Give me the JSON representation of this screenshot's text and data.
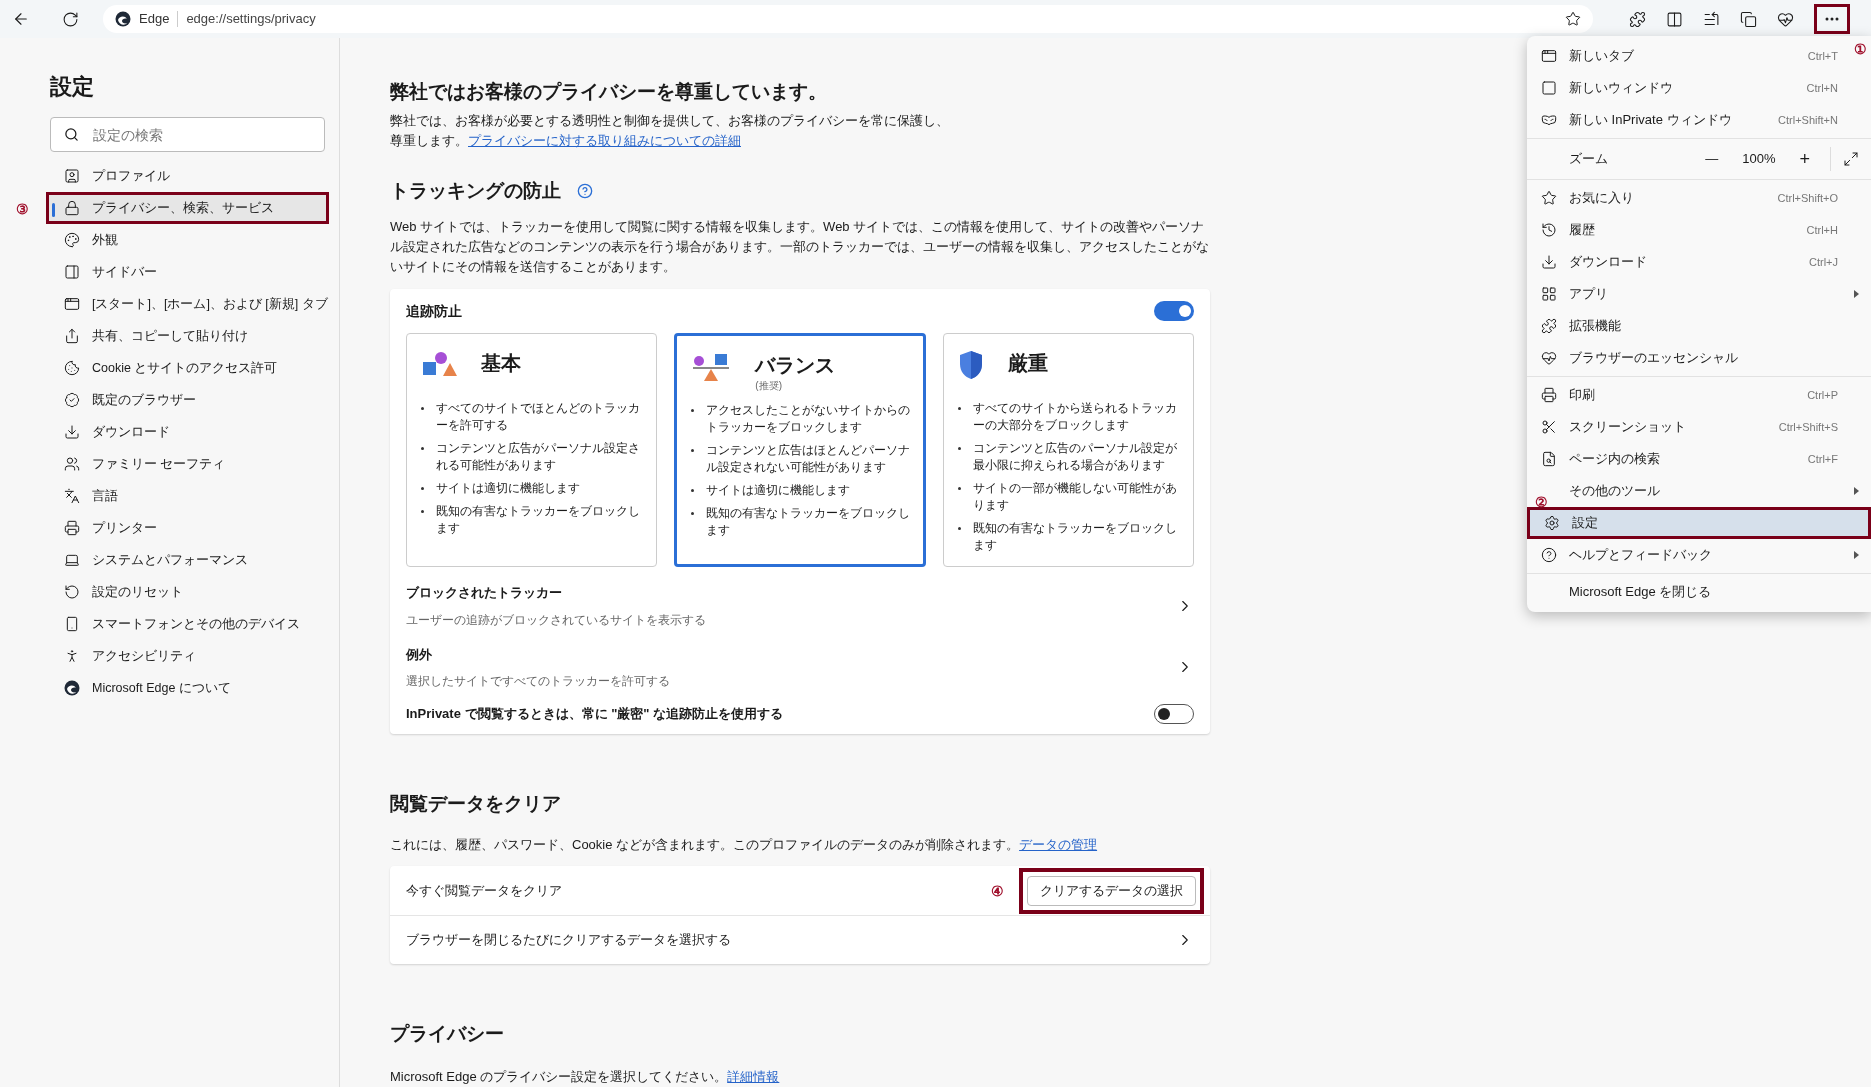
{
  "toolbar": {
    "site_label": "Edge",
    "url": "edge://settings/privacy",
    "more_callout": "①"
  },
  "sidebar": {
    "title": "設定",
    "search": {
      "placeholder": "設定の検索"
    },
    "items": [
      {
        "label": "プロファイル",
        "selected": false
      },
      {
        "label": "プライバシー、検索、サービス",
        "selected": true,
        "callout": "③"
      },
      {
        "label": "外観",
        "selected": false
      },
      {
        "label": "サイドバー",
        "selected": false
      },
      {
        "label": "[スタート]、[ホーム]、および [新規] タブ",
        "selected": false
      },
      {
        "label": "共有、コピーして貼り付け",
        "selected": false
      },
      {
        "label": "Cookie とサイトのアクセス許可",
        "selected": false
      },
      {
        "label": "既定のブラウザー",
        "selected": false
      },
      {
        "label": "ダウンロード",
        "selected": false
      },
      {
        "label": "ファミリー セーフティ",
        "selected": false
      },
      {
        "label": "言語",
        "selected": false
      },
      {
        "label": "プリンター",
        "selected": false
      },
      {
        "label": "システムとパフォーマンス",
        "selected": false
      },
      {
        "label": "設定のリセット",
        "selected": false
      },
      {
        "label": "スマートフォンとその他のデバイス",
        "selected": false
      },
      {
        "label": "アクセシビリティ",
        "selected": false
      },
      {
        "label": "Microsoft Edge について",
        "selected": false
      }
    ]
  },
  "intro": {
    "title": "弊社ではお客様のプライバシーを尊重しています。",
    "text": "弊社では、お客様が必要とする透明性と制御を提供して、お客様のプライバシーを常に保護し、尊重します。",
    "link": "プライバシーに対する取り組みについての詳細"
  },
  "tracking": {
    "title": "トラッキングの防止",
    "description": "Web サイトでは、トラッカーを使用して閲覧に関する情報を収集します。Web サイトでは、この情報を使用して、サイトの改善やパーソナル設定された広告などのコンテンツの表示を行う場合があります。一部のトラッカーでは、ユーザーの情報を収集し、アクセスしたことがないサイトにその情報を送信することがあります。",
    "card_title": "追跡防止",
    "on": true,
    "levels": [
      {
        "title": "基本",
        "selected": false,
        "bullets": [
          "すべてのサイトでほとんどのトラッカーを許可する",
          "コンテンツと広告がパーソナル設定される可能性があります",
          "サイトは適切に機能します",
          "既知の有害なトラッカーをブロックします"
        ]
      },
      {
        "title": "バランス",
        "subtitle": "(推奨)",
        "selected": true,
        "bullets": [
          "アクセスしたことがないサイトからのトラッカーをブロックします",
          "コンテンツと広告はほとんどパーソナル設定されない可能性があります",
          "サイトは適切に機能します",
          "既知の有害なトラッカーをブロックします"
        ]
      },
      {
        "title": "厳重",
        "selected": false,
        "bullets": [
          "すべてのサイトから送られるトラッカーの大部分をブロックします",
          "コンテンツと広告のパーソナル設定が最小限に抑えられる場合があります",
          "サイトの一部が機能しない可能性があります",
          "既知の有害なトラッカーをブロックします"
        ]
      }
    ],
    "rows": [
      {
        "title": "ブロックされたトラッカー",
        "description": "ユーザーの追跡がブロックされているサイトを表示する"
      },
      {
        "title": "例外",
        "description": "選択したサイトですべてのトラッカーを許可する"
      }
    ],
    "inprivate": {
      "label": "InPrivate で閲覧するときは、常に \"厳密\" な追跡防止を使用する",
      "on": false
    }
  },
  "clear": {
    "title": "閲覧データをクリア",
    "text": "これには、履歴、パスワード、Cookie などが含まれます。このプロファイルのデータのみが削除されます。",
    "link": "データの管理",
    "rows": [
      {
        "kind": "button",
        "label": "今すぐ閲覧データをクリア",
        "button": "クリアするデータの選択",
        "callout": "④"
      },
      {
        "kind": "chevron",
        "label": "ブラウザーを閉じるたびにクリアするデータを選択する"
      }
    ]
  },
  "privacy": {
    "title": "プライバシー",
    "text": "Microsoft Edge のプライバシー設定を選択してください。",
    "link": "詳細情報"
  },
  "menu": {
    "groups": [
      [
        {
          "kind": "item",
          "label": "新しいタブ",
          "shortcut": "Ctrl+T"
        },
        {
          "kind": "item",
          "label": "新しいウィンドウ",
          "shortcut": "Ctrl+N"
        },
        {
          "kind": "item",
          "label": "新しい InPrivate ウィンドウ",
          "shortcut": "Ctrl+Shift+N"
        }
      ],
      [
        {
          "kind": "zoom",
          "label": "ズーム",
          "minus": "—",
          "value": "100%",
          "plus": "+"
        }
      ],
      [
        {
          "kind": "item",
          "label": "お気に入り",
          "shortcut": "Ctrl+Shift+O"
        },
        {
          "kind": "item",
          "label": "履歴",
          "shortcut": "Ctrl+H"
        },
        {
          "kind": "item",
          "label": "ダウンロード",
          "shortcut": "Ctrl+J"
        },
        {
          "kind": "item",
          "label": "アプリ",
          "submenu": true
        },
        {
          "kind": "item",
          "label": "拡張機能"
        },
        {
          "kind": "item",
          "label": "ブラウザーのエッセンシャル"
        }
      ],
      [
        {
          "kind": "item",
          "label": "印刷",
          "shortcut": "Ctrl+P"
        },
        {
          "kind": "item",
          "label": "スクリーンショット",
          "shortcut": "Ctrl+Shift+S"
        },
        {
          "kind": "item",
          "label": "ページ内の検索",
          "shortcut": "Ctrl+F"
        },
        {
          "kind": "item",
          "label": "その他のツール",
          "submenu": true
        },
        {
          "kind": "item",
          "label": "設定",
          "selected": true,
          "callout": "②"
        },
        {
          "kind": "item",
          "label": "ヘルプとフィードバック",
          "submenu": true
        }
      ],
      [
        {
          "kind": "item",
          "label": "Microsoft Edge を閉じる"
        }
      ]
    ]
  }
}
